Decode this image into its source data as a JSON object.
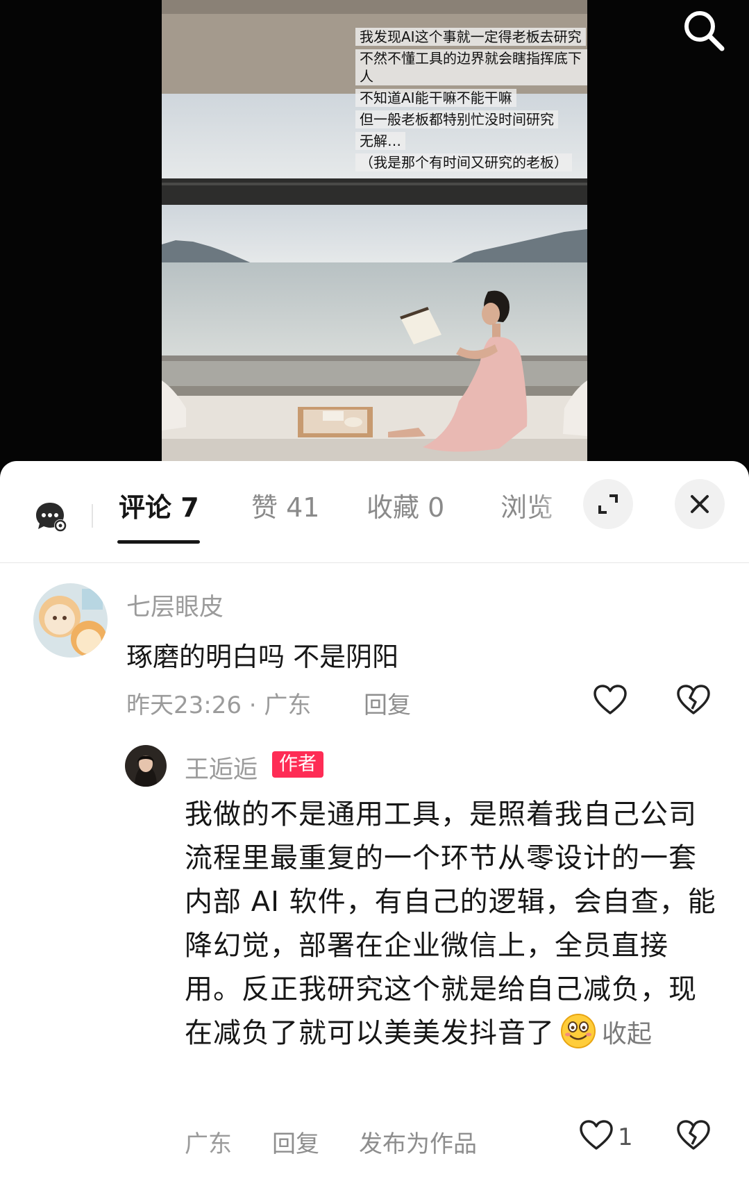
{
  "video": {
    "overlay_lines": [
      "我发现AI这个事就一定得老板去研究",
      "不然不懂工具的边界就会瞎指挥底下人",
      "不知道AI能干嘛不能干嘛",
      "但一般老板都特别忙没时间研究",
      "无解…",
      "（我是那个有时间又研究的老板）"
    ],
    "search_icon": "search-icon"
  },
  "panel": {
    "tabs": [
      {
        "label": "评论 7",
        "active": true
      },
      {
        "label": "赞 41",
        "active": false
      },
      {
        "label": "收藏 0",
        "active": false
      },
      {
        "label": "浏览",
        "active": false
      }
    ],
    "settings_icon": "comment-settings-icon",
    "expand_icon": "expand-icon",
    "close_icon": "close-icon"
  },
  "comments": [
    {
      "username": "七层眼皮",
      "text": "琢磨的明白吗 不是阴阳",
      "time_location": "昨天23:26 · 广东",
      "reply_label": "回复"
    }
  ],
  "reply": {
    "username": "王逅逅",
    "badge": "作者",
    "text": "我做的不是通用工具，是照着我自己公司流程里最重复的一个环节从零设计的一套内部 AI 软件，有自己的逻辑，会自查，能降幻觉，部署在企业微信上，全员直接用。反正我研究这个就是给自己减负，现在减负了就可以美美发抖音了",
    "collapse_label": "收起",
    "location": "广东",
    "reply_label": "回复",
    "publish_label": "发布为作品",
    "like_count": "1"
  },
  "colors": {
    "accent_badge": "#fe2c55",
    "text_primary": "#161616",
    "text_secondary": "#9b9b9b"
  }
}
